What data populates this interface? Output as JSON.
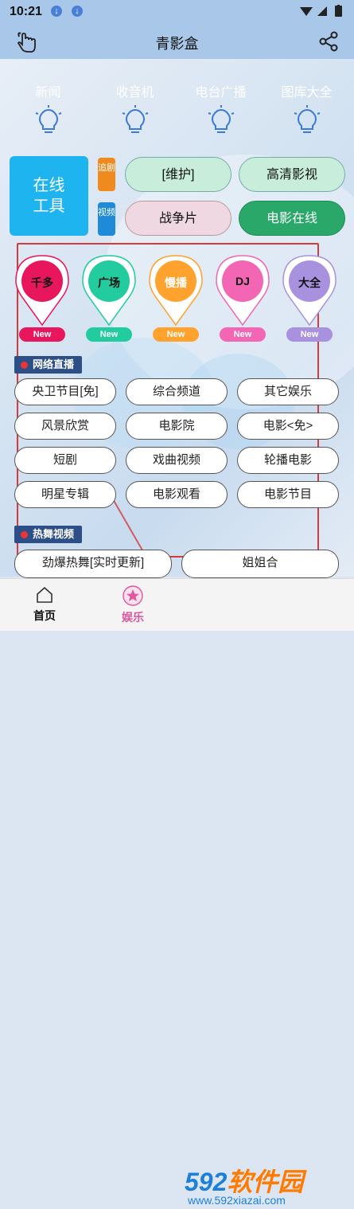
{
  "status": {
    "time": "10:21"
  },
  "app": {
    "title": "青影盒"
  },
  "cards": [
    {
      "label": "新闻",
      "color": "#9b45cf"
    },
    {
      "label": "收音机",
      "color": "#1ebe3c"
    },
    {
      "label": "电台广播",
      "color": "#ff5520"
    },
    {
      "label": "图库大全",
      "color": "#a7b6c9"
    }
  ],
  "tools": {
    "line1": "在线",
    "line2": "工具"
  },
  "tags": [
    {
      "label": "追剧",
      "color": "#f08a1e"
    },
    {
      "label": "视频",
      "color": "#1e8ad8"
    }
  ],
  "pills": [
    {
      "label": "[维护]"
    },
    {
      "label": "高清影视"
    },
    {
      "label": "战争片"
    },
    {
      "label": "电影在线"
    }
  ],
  "pins": [
    {
      "label": "千多",
      "color": "#e8175d",
      "badge": "New"
    },
    {
      "label": "广场",
      "color": "#22cc9f",
      "badge": "New"
    },
    {
      "label": "慢播",
      "color": "#ffa22e",
      "badge": "New"
    },
    {
      "label": "DJ",
      "color": "#f266b3",
      "badge": "New"
    },
    {
      "label": "大全",
      "color": "#a892e0",
      "badge": "New"
    }
  ],
  "sections": {
    "live": "网络直播",
    "dance": "热舞视频"
  },
  "live_items": [
    "央卫节目[免]",
    "综合频道",
    "其它娱乐",
    "风景欣赏",
    "电影院",
    "电影<免>",
    "短剧",
    "戏曲视频",
    "轮播电影",
    "明星专辑",
    "电影观看",
    "电影节目"
  ],
  "dance_items": [
    "劲爆热舞[实时更新]",
    "姐姐合"
  ],
  "tabs": {
    "home": "首页",
    "fun": "娱乐"
  },
  "watermark": {
    "brand_a": "592",
    "brand_b": "软件园",
    "url": "www.592xiazai.com"
  }
}
